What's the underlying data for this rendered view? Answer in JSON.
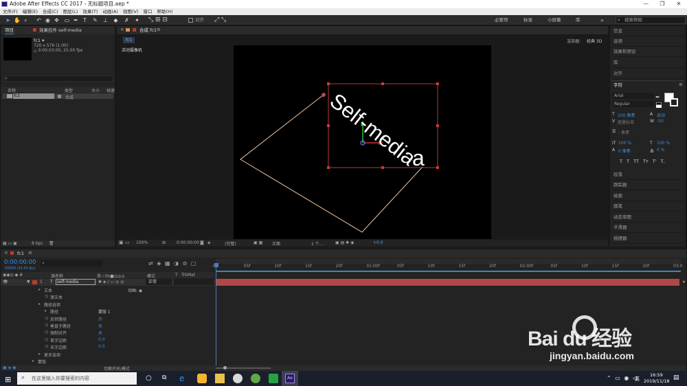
{
  "window": {
    "title": "Adobe After Effects CC 2017 - 无标题项目.aep *",
    "min": "—",
    "max": "❐",
    "close": "✕"
  },
  "menu": [
    "文件(F)",
    "编辑(E)",
    "合成(C)",
    "图层(L)",
    "效果(T)",
    "动画(A)",
    "视图(V)",
    "窗口",
    "帮助(H)"
  ],
  "toolbar": {
    "align_label": "对齐",
    "workspaces": [
      "必要项",
      "标准",
      "小屏幕",
      "库"
    ],
    "search_placeholder": "搜索帮助"
  },
  "project": {
    "tab": "项目",
    "effects_tab": "效果控件 self-media",
    "comp_name": "fc1 ▾",
    "comp_info1": "720 x 576 (1.00)",
    "comp_info2": "△ 0:00:03:00, 25.00 fps",
    "columns": [
      "名称",
      "类型",
      "大小",
      "帧速"
    ],
    "items": [
      {
        "name": "fc1",
        "type": "合成"
      }
    ],
    "bpc": "8 bpc"
  },
  "comp": {
    "tab": "合成 fc1",
    "crumb": "fc1",
    "renderer_label": "渲染器：",
    "renderer": "经典 3D",
    "view_label": "活动摄像机",
    "text_lines": [
      "Self-media",
      "a"
    ],
    "zoom": "100%",
    "timecode": "0:00:00:00",
    "resolution": "(完整)",
    "view_mode": "正面",
    "views": "1 个...",
    "offset": "+0.0"
  },
  "right_panels": [
    "信息",
    "音频",
    "效果和预设",
    "库",
    "对齐"
  ],
  "character": {
    "title": "字符",
    "font": "Arial",
    "style": "Regular",
    "size": "100 像素",
    "leading": "自动",
    "kerning": "度量标准",
    "tracking": "-50",
    "stroke": "- 像素",
    "vscale": "100 %",
    "hscale": "100 %",
    "baseline": "0 像素",
    "tsume": "0 %",
    "buttons": [
      "T",
      "T",
      "TT",
      "Tт",
      "T'",
      "T,"
    ]
  },
  "right_panels2": [
    "段落",
    "跟踪器",
    "绘画",
    "画笔",
    "动态草图",
    "平滑器",
    "摇摆器"
  ],
  "timeline": {
    "tab": "fc1",
    "timecode": "0:00:00:00",
    "timecode_sub": "00000 (25.00 fps)",
    "columns": [
      "源名称",
      "单☆\\fx■◎◎◎",
      "模式",
      "T",
      "TrkMat"
    ],
    "layer": {
      "num": "1",
      "name": "self-media",
      "mode": "正常"
    },
    "props": [
      {
        "indent": 1,
        "label": "文本",
        "value": "动画: ◉"
      },
      {
        "indent": 2,
        "label": "源文本",
        "value": ""
      },
      {
        "indent": 1,
        "label": "路径选项",
        "value": ""
      },
      {
        "indent": 2,
        "label": "路径",
        "value": "蒙版 1"
      },
      {
        "indent": 2,
        "label": "反转路径",
        "value": "开"
      },
      {
        "indent": 2,
        "label": "垂直于路径",
        "value": "关"
      },
      {
        "indent": 2,
        "label": "强制对齐",
        "value": "关"
      },
      {
        "indent": 2,
        "label": "首字边距",
        "value": "0.0"
      },
      {
        "indent": 2,
        "label": "末字边距",
        "value": "0.0"
      },
      {
        "indent": 1,
        "label": "更多选项",
        "value": ""
      },
      {
        "indent": 0,
        "label": "蒙版",
        "value": ""
      }
    ],
    "ruler": [
      "0s",
      "05f",
      "10f",
      "15f",
      "20f",
      "01:00f",
      "05f",
      "10f",
      "15f",
      "20f",
      "02:00f",
      "05f",
      "10f",
      "15f",
      "20f",
      "03:0"
    ],
    "footer": "切换开关/模式"
  },
  "taskbar": {
    "search_placeholder": "在这里输入你要搜索的内容",
    "time": "16:59",
    "date": "2019/11/18",
    "ime": "英"
  },
  "watermark": {
    "brand": "Bai du 经验",
    "url": "jingyan.baidu.com"
  }
}
